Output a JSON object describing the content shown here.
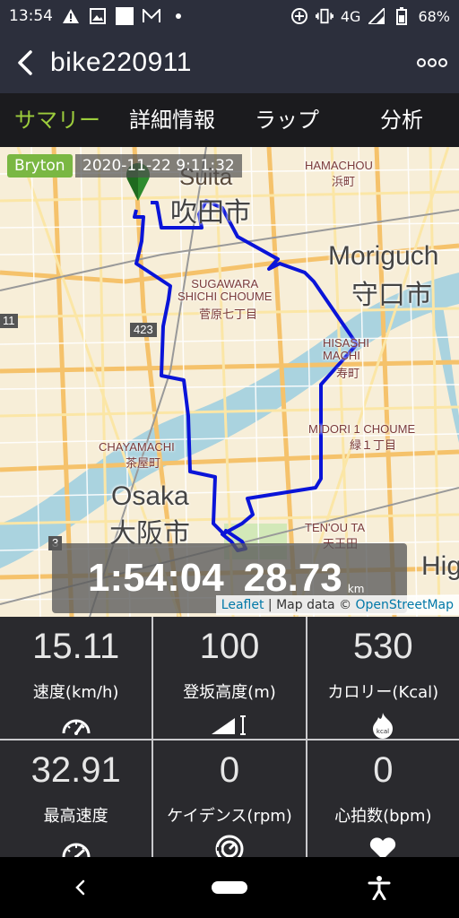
{
  "status_bar": {
    "time": "13:54",
    "network": "4G",
    "battery": "68%",
    "icons": [
      "alert-icon",
      "image-icon",
      "square-icon",
      "mail-icon",
      "dot-icon",
      "hotspot-icon",
      "vibrate-icon",
      "signal-icon",
      "battery-icon"
    ]
  },
  "app_bar": {
    "title": "bike220911",
    "back_icon": "chevron-left-icon",
    "more_icon": "more-horizontal-icon"
  },
  "tabs": [
    {
      "label": "サマリー",
      "active": true
    },
    {
      "label": "詳細情報",
      "active": false
    },
    {
      "label": "ラップ",
      "active": false
    },
    {
      "label": "分析",
      "active": false
    }
  ],
  "map": {
    "brand": "Bryton",
    "datetime": "2020-11-22 9:11:32",
    "labels": {
      "suita": "Suita",
      "suita_jp": "吹田市",
      "hamachou": "HAMACHOU",
      "hamachou_jp": "浜町",
      "moriguchi": "Moriguch",
      "moriguchi_jp": "守口市",
      "sugawara": "SUGAWARA\nSHICHI CHOUME",
      "sugawara_jp": "菅原七丁目",
      "hishi": "HISASHI\nMACHI",
      "hishi_jp": "寿町",
      "chayamachi": "CHAYAMACHI",
      "chayamachi_jp": "茶屋町",
      "midori": "MIDORI 1 CHOUME",
      "midori_jp": "緑１丁目",
      "osaka": "Osaka",
      "osaka_jp": "大阪市",
      "tenouta": "TEN'OU TA",
      "tenouta_jp": "天王田",
      "road_423": "423",
      "road_3": "3",
      "road_11": "11",
      "hig": "Hig"
    },
    "duration": "1:54:04",
    "distance": "28.73",
    "distance_unit": "km",
    "attribution": {
      "leaflet": "Leaflet",
      "sep": " | Map data © ",
      "osm": "OpenStreetMap"
    },
    "route_color": "#0a14d8",
    "marker_color": "#2e8b2e"
  },
  "stats": [
    {
      "value": "15.11",
      "label": "速度(km/h)",
      "icon": "speedometer-icon"
    },
    {
      "value": "100",
      "label": "登坂高度(m)",
      "icon": "elevation-icon"
    },
    {
      "value": "530",
      "label": "カロリー(Kcal)",
      "icon": "kcal-flame-icon"
    },
    {
      "value": "32.91",
      "label": "最高速度",
      "icon": "max-speed-icon"
    },
    {
      "value": "0",
      "label": "ケイデンス(rpm)",
      "icon": "cadence-icon"
    },
    {
      "value": "0",
      "label": "心拍数(bpm)",
      "icon": "heart-icon"
    }
  ],
  "accent_color": "#9ccc3c"
}
